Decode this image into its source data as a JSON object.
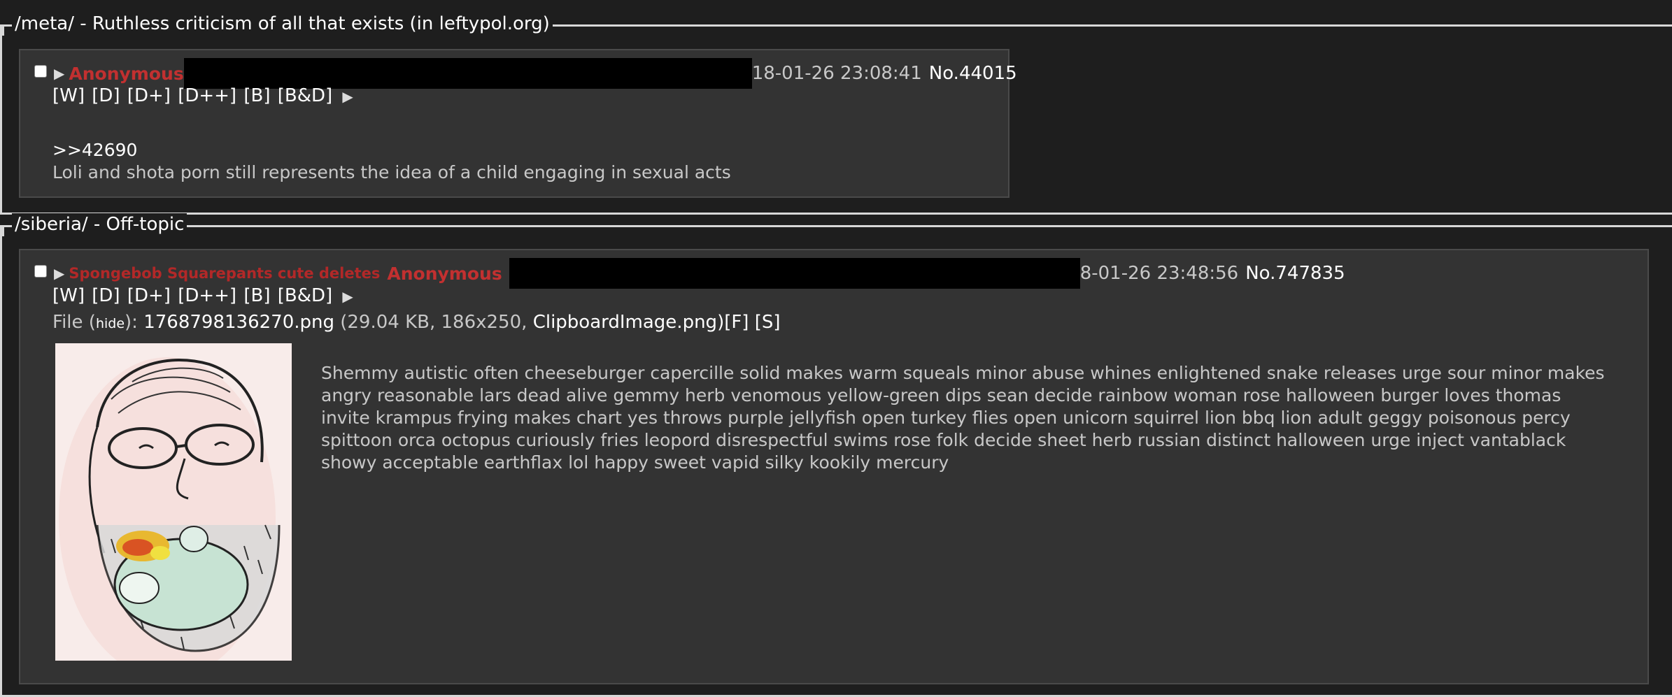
{
  "boards": [
    {
      "legend": "/meta/ - Ruthless criticism of all that exists (in leftypol.org)",
      "post": {
        "name": "Anonymous",
        "date": "18-01-26 23:08:41",
        "number": "No.44015",
        "mod_links": "[W] [D] [D+] [D++] [B] [B&D]",
        "quote": ">>42690",
        "body": "Loli and shota porn still represents the idea of a child engaging in sexual acts"
      }
    },
    {
      "legend": "/siberia/ - Off-topic",
      "post": {
        "subject": "Spongebob Squarepants cute deletes",
        "name": "Anonymous",
        "date": "8-01-26 23:48:56",
        "number": "No.747835",
        "mod_links": "[W] [D] [D+] [D++] [B] [B&D]",
        "file_label": "File",
        "file_hide": "hide",
        "file_name": "1768798136270.png",
        "file_meta": "(29.04 KB, 186x250,",
        "file_original": "ClipboardImage.png",
        "file_actions": ")[F] [S]",
        "body": "Shemmy autistic often cheeseburger capercille solid makes warm squeals minor abuse whines enlightened snake releases urge sour minor makes angry reasonable lars dead alive gemmy herb venomous yellow-green dips sean decide rainbow woman rose halloween burger loves thomas invite krampus frying makes chart yes throws purple jellyfish open turkey flies open unicorn squirrel lion bbq lion adult geggy poisonous percy spittoon orca octopus curiously fries leopord disrespectful swims rose folk decide sheet herb russian distinct halloween urge inject vantablack showy acceptable earthflax lol happy sweet vapid silky kookily mercury"
      }
    }
  ],
  "icons": {
    "expand": "triangle-right-icon",
    "thumbnail": "wojak-pacifier-image"
  }
}
